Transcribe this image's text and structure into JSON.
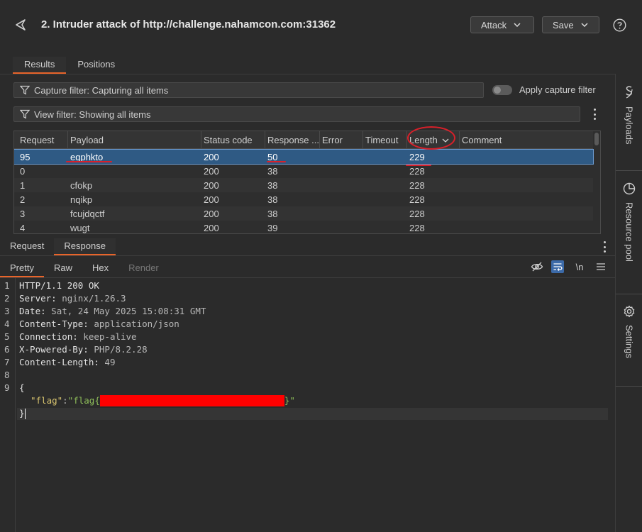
{
  "header": {
    "title": "2. Intruder attack of http://challenge.nahamcon.com:31362",
    "attack_label": "Attack",
    "save_label": "Save"
  },
  "top_tabs": [
    {
      "label": "Results",
      "active": true
    },
    {
      "label": "Positions",
      "active": false
    }
  ],
  "filters": {
    "capture": "Capture filter: Capturing all items",
    "apply_capture": "Apply capture filter",
    "view": "View filter: Showing all items"
  },
  "table": {
    "columns": [
      "Request",
      "Payload",
      "Status code",
      "Response ...",
      "Error",
      "Timeout",
      "Length",
      "Comment"
    ],
    "sorted_column": "Length",
    "rows": [
      {
        "request": "95",
        "payload": "eqphkto",
        "status": "200",
        "response": "50",
        "error": "",
        "timeout": "",
        "length": "229",
        "comment": "",
        "selected": true
      },
      {
        "request": "0",
        "payload": "",
        "status": "200",
        "response": "38",
        "error": "",
        "timeout": "",
        "length": "228",
        "comment": ""
      },
      {
        "request": "1",
        "payload": "cfokp",
        "status": "200",
        "response": "38",
        "error": "",
        "timeout": "",
        "length": "228",
        "comment": ""
      },
      {
        "request": "2",
        "payload": "nqikp",
        "status": "200",
        "response": "38",
        "error": "",
        "timeout": "",
        "length": "228",
        "comment": ""
      },
      {
        "request": "3",
        "payload": "fcujdqctf",
        "status": "200",
        "response": "38",
        "error": "",
        "timeout": "",
        "length": "228",
        "comment": ""
      },
      {
        "request": "4",
        "payload": "wugt",
        "status": "200",
        "response": "39",
        "error": "",
        "timeout": "",
        "length": "228",
        "comment": ""
      }
    ]
  },
  "rr_tabs": [
    {
      "label": "Request",
      "active": false
    },
    {
      "label": "Response",
      "active": true
    }
  ],
  "view_tabs": [
    {
      "label": "Pretty",
      "active": true
    },
    {
      "label": "Raw"
    },
    {
      "label": "Hex"
    },
    {
      "label": "Render",
      "disabled": true
    }
  ],
  "toolbar": {
    "newline_label": "\\n"
  },
  "response": {
    "line_numbers": [
      "1",
      "2",
      "3",
      "4",
      "5",
      "6",
      "7",
      "8",
      "9"
    ],
    "status_line": "HTTP/1.1 200 OK",
    "headers": [
      {
        "name": "Server:",
        "value": " nginx/1.26.3"
      },
      {
        "name": "Date:",
        "value": " Sat, 24 May 2025 15:08:31 GMT"
      },
      {
        "name": "Content-Type:",
        "value": " application/json"
      },
      {
        "name": "Connection:",
        "value": " keep-alive"
      },
      {
        "name": "X-Powered-By:",
        "value": " PHP/8.2.28"
      },
      {
        "name": "Content-Length:",
        "value": " 49"
      }
    ],
    "body_open": "{",
    "flag_key": "\"flag\"",
    "flag_colon": ":",
    "flag_value_start": "\"flag{",
    "flag_value_end": "}\"",
    "body_close": "}"
  },
  "sidebar": {
    "items": [
      {
        "label": "Payloads",
        "icon": "payloads-icon"
      },
      {
        "label": "Resource pool",
        "icon": "resource-pool-icon"
      },
      {
        "label": "Settings",
        "icon": "gear-icon"
      }
    ]
  },
  "colors": {
    "accent": "#e8642a",
    "selection": "#2f5a84",
    "annotation": "#d8202a",
    "redaction": "#ff0000"
  }
}
